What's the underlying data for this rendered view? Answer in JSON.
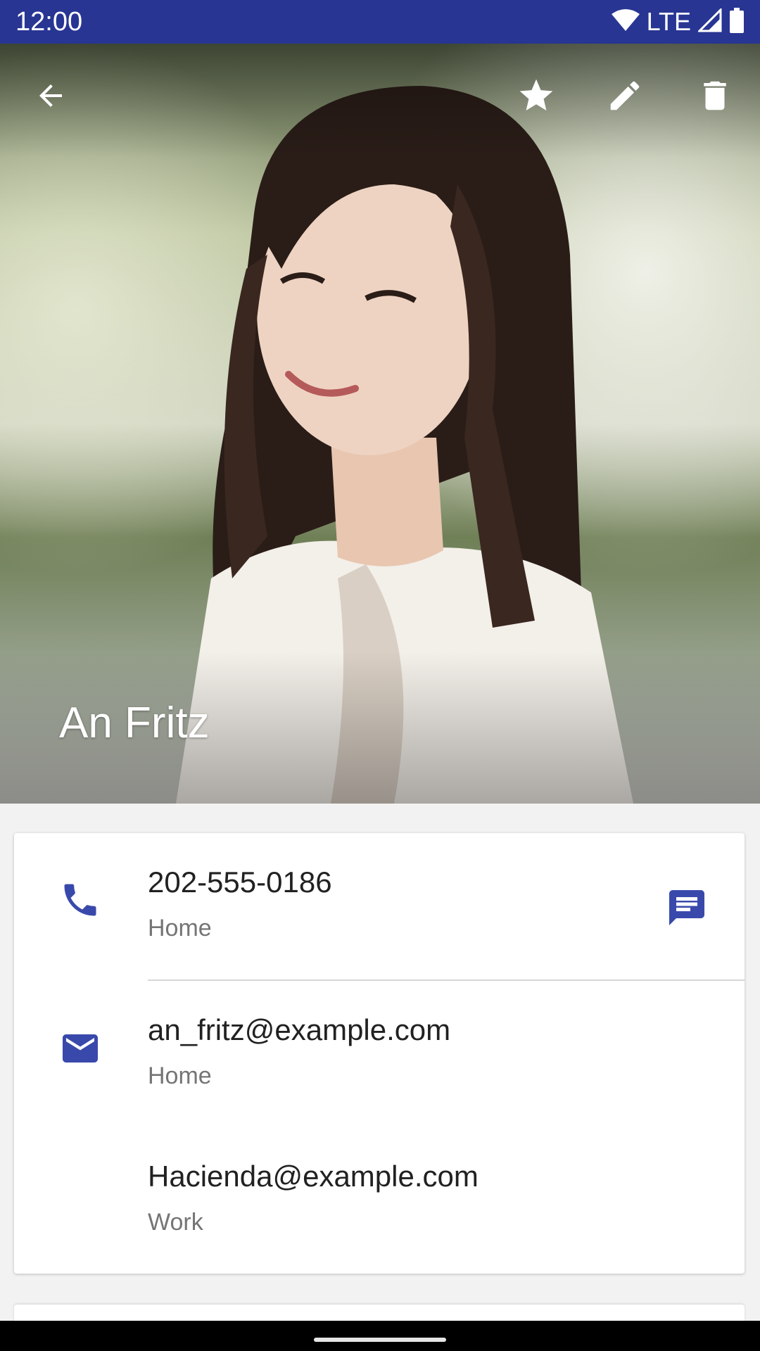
{
  "status_bar": {
    "time": "12:00",
    "network": "LTE",
    "icons": [
      "wifi-icon",
      "signal-icon",
      "battery-icon"
    ]
  },
  "toolbar": {
    "icons": [
      "back-arrow-icon",
      "star-icon",
      "edit-pencil-icon",
      "delete-trash-icon"
    ]
  },
  "contact": {
    "name": "An Fritz"
  },
  "details": {
    "phone": {
      "icon": "phone-icon",
      "number": "202-555-0186",
      "type": "Home",
      "action_icon": "message-icon"
    },
    "emails": [
      {
        "icon": "email-icon",
        "address": "an_fritz@example.com",
        "type": "Home"
      },
      {
        "address": "Hacienda@example.com",
        "type": "Work"
      }
    ]
  },
  "colors": {
    "status_bar": "#283593",
    "accent": "#3949ab",
    "primary_text": "#212121",
    "secondary_text": "#757575"
  }
}
